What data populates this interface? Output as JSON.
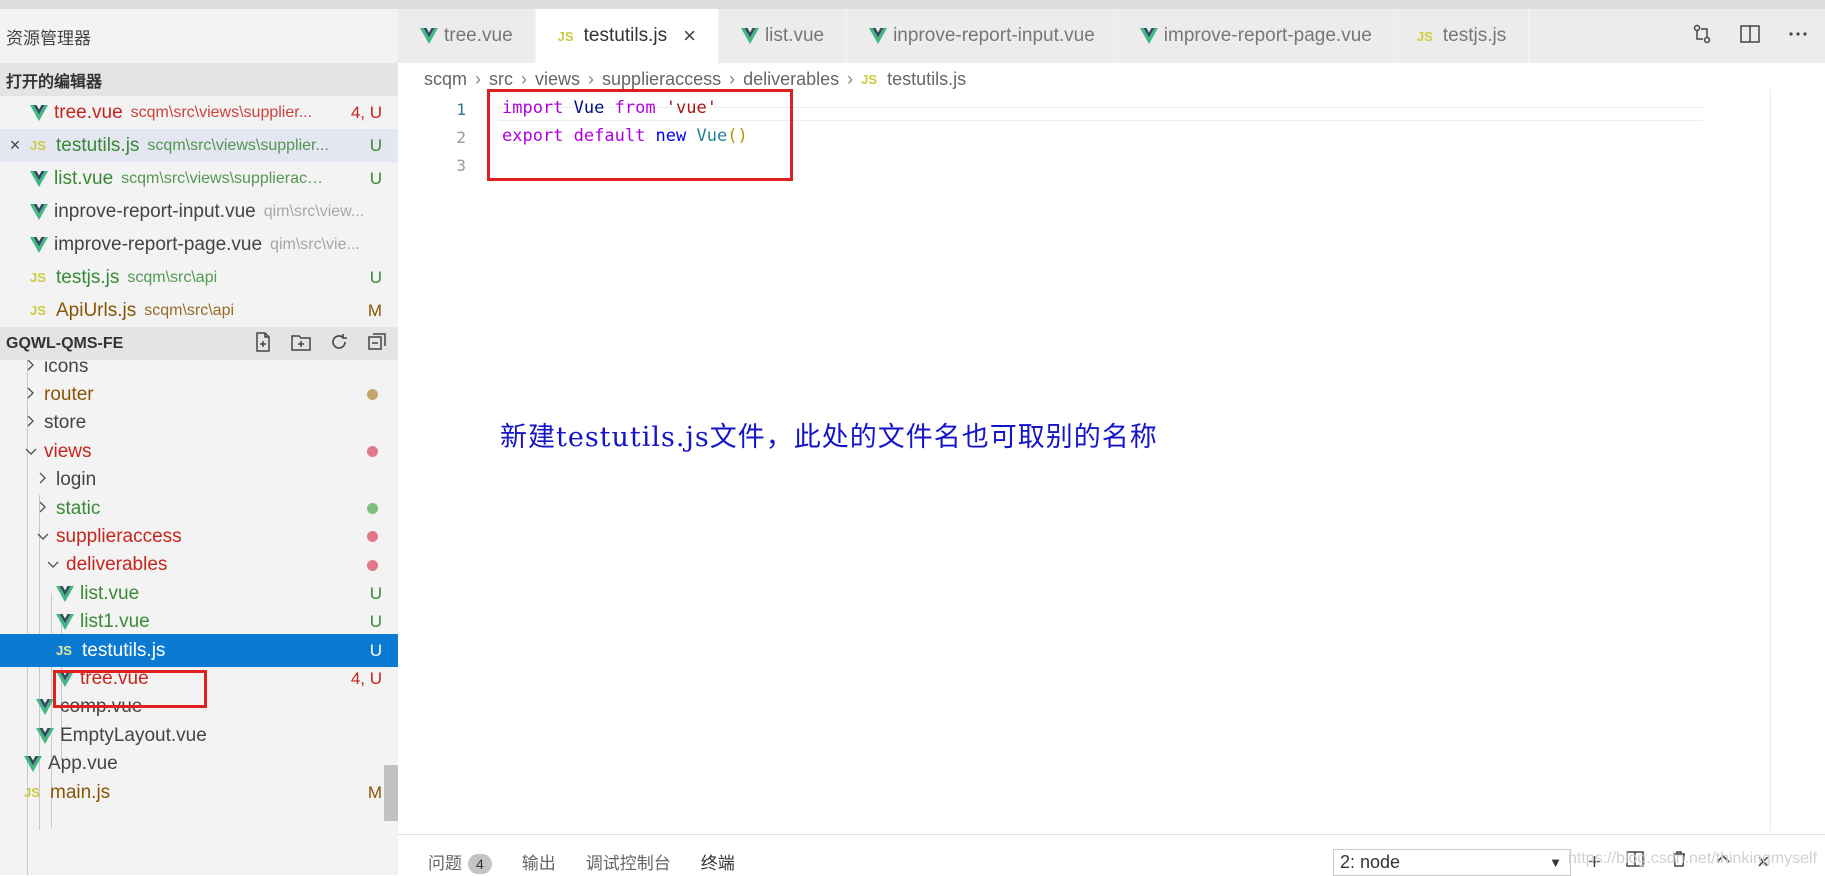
{
  "explorer": {
    "title": "资源管理器",
    "open_editors_title": "打开的编辑器",
    "open_editors": [
      {
        "name": "tree.vue",
        "path": "scqm\\src\\views\\supplier...",
        "status": "4, U",
        "icon": "vue-icon",
        "color": "#c5251c",
        "close": ""
      },
      {
        "name": "testutils.js",
        "path": "scqm\\src\\views\\supplier...",
        "status": "U",
        "icon": "js-icon",
        "color": "#388a34",
        "close": "×"
      },
      {
        "name": "list.vue",
        "path": "scqm\\src\\views\\supplieracc...",
        "status": "U",
        "icon": "vue-icon",
        "color": "#388a34",
        "close": ""
      },
      {
        "name": "inprove-report-input.vue",
        "path": "qim\\src\\view...",
        "status": "",
        "icon": "vue-icon",
        "color": "#444444",
        "close": ""
      },
      {
        "name": "improve-report-page.vue",
        "path": "qim\\src\\vie...",
        "status": "",
        "icon": "vue-icon",
        "color": "#444444",
        "close": ""
      },
      {
        "name": "testjs.js",
        "path": "scqm\\src\\api",
        "status": "U",
        "icon": "js-icon",
        "color": "#388a34",
        "close": ""
      },
      {
        "name": "ApiUrls.js",
        "path": "scqm\\src\\api",
        "status": "M",
        "icon": "js-icon",
        "color": "#895503",
        "close": ""
      }
    ],
    "workspace_title": "GQWL-QMS-FE",
    "tree": [
      {
        "label": "icons",
        "chev": "›",
        "color": "#444444"
      },
      {
        "label": "router",
        "chev": "›",
        "color": "#895503",
        "dot": "#c5a56e"
      },
      {
        "label": "store",
        "chev": "›",
        "color": "#444444"
      },
      {
        "label": "views",
        "chev": "⌄",
        "color": "#c5251c",
        "dot": "#e1788a"
      },
      {
        "label": "login",
        "chev": "›",
        "color": "#444444"
      },
      {
        "label": "static",
        "chev": "›",
        "color": "#388a34",
        "dot": "#7ec07b"
      },
      {
        "label": "supplieraccess",
        "chev": "⌄",
        "color": "#c5251c",
        "dot": "#e1788a"
      },
      {
        "label": "deliverables",
        "chev": "⌄",
        "color": "#c5251c",
        "dot": "#e1788a"
      },
      {
        "label": "list.vue",
        "color": "#388a34",
        "status": "U"
      },
      {
        "label": "list1.vue",
        "color": "#388a34",
        "status": "U"
      },
      {
        "label": "testutils.js",
        "color": "#ffffff",
        "status": "U"
      },
      {
        "label": "tree.vue",
        "color": "#c5251c",
        "status": "4, U"
      },
      {
        "label": "comp.vue",
        "color": "#444444"
      },
      {
        "label": "EmptyLayout.vue",
        "color": "#444444"
      },
      {
        "label": "App.vue",
        "color": "#444444"
      },
      {
        "label": "main.js",
        "color": "#895503",
        "status": "M"
      }
    ]
  },
  "tabs": [
    {
      "label": "tree.vue",
      "icon": "vue-icon"
    },
    {
      "label": "testutils.js",
      "icon": "js-icon",
      "close": "×"
    },
    {
      "label": "list.vue",
      "icon": "vue-icon"
    },
    {
      "label": "inprove-report-input.vue",
      "icon": "vue-icon"
    },
    {
      "label": "improve-report-page.vue",
      "icon": "vue-icon"
    },
    {
      "label": "testjs.js",
      "icon": "js-icon"
    }
  ],
  "js_badge": "JS",
  "breadcrumb": [
    "scqm",
    "src",
    "views",
    "supplieraccess",
    "deliverables",
    "testutils.js"
  ],
  "code": {
    "line_numbers": [
      "1",
      "2",
      "3"
    ],
    "line1": {
      "kw": "import",
      "name": " Vue ",
      "from": "from",
      "str": " 'vue'"
    },
    "line2": {
      "kw": "export",
      "kw2": " default ",
      "kw3": "new",
      "ty": " Vue",
      "par": "()"
    }
  },
  "annotation": "新建testutils.js文件，此处的文件名也可取别的名称",
  "panel": {
    "tabs": [
      "问题",
      "输出",
      "调试控制台",
      "终端"
    ],
    "problems_count": "4",
    "terminal_select": "2: node",
    "add": "+",
    "close": "×"
  },
  "watermark": "https://blog.csdn.net/thinkingmyself"
}
